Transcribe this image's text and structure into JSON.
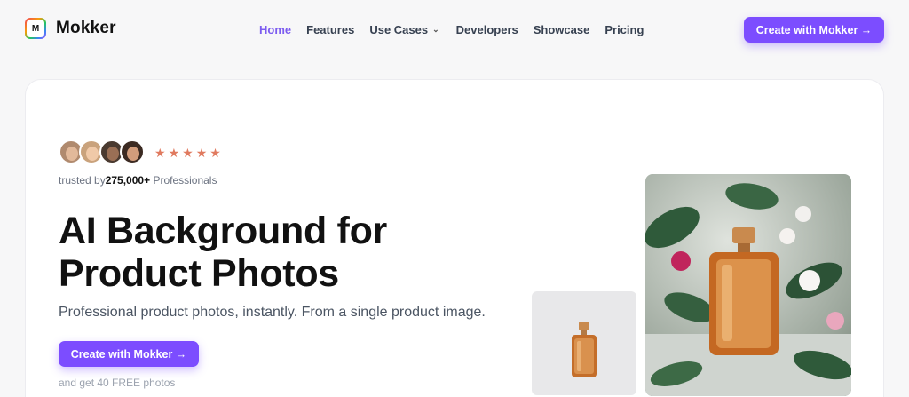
{
  "brand": {
    "logo_letter": "M",
    "name": "Mokker"
  },
  "nav": {
    "links": [
      {
        "label": "Home",
        "active": true
      },
      {
        "label": "Features"
      },
      {
        "label": "Use Cases",
        "has_dropdown": true
      },
      {
        "label": "Developers"
      },
      {
        "label": "Showcase"
      },
      {
        "label": "Pricing"
      }
    ],
    "cta_label": "Create with Mokker →"
  },
  "hero": {
    "rating_stars": 5,
    "trusted_prefix": "trusted by",
    "trusted_count": "275,000+",
    "trusted_suffix": "Professionals",
    "headline_line1": "AI Background for",
    "headline_line2": "Product Photos",
    "subheadline": "Professional product photos, instantly. From a single product image.",
    "cta_label": "Create with Mokker →",
    "free_note": "and get 40 FREE photos"
  },
  "colors": {
    "accent": "#7c4dff",
    "active_link": "#7c5cf0",
    "stars": "#e07a5f"
  },
  "icons": {
    "dropdown": "chevron-down-icon",
    "star": "star-icon"
  }
}
